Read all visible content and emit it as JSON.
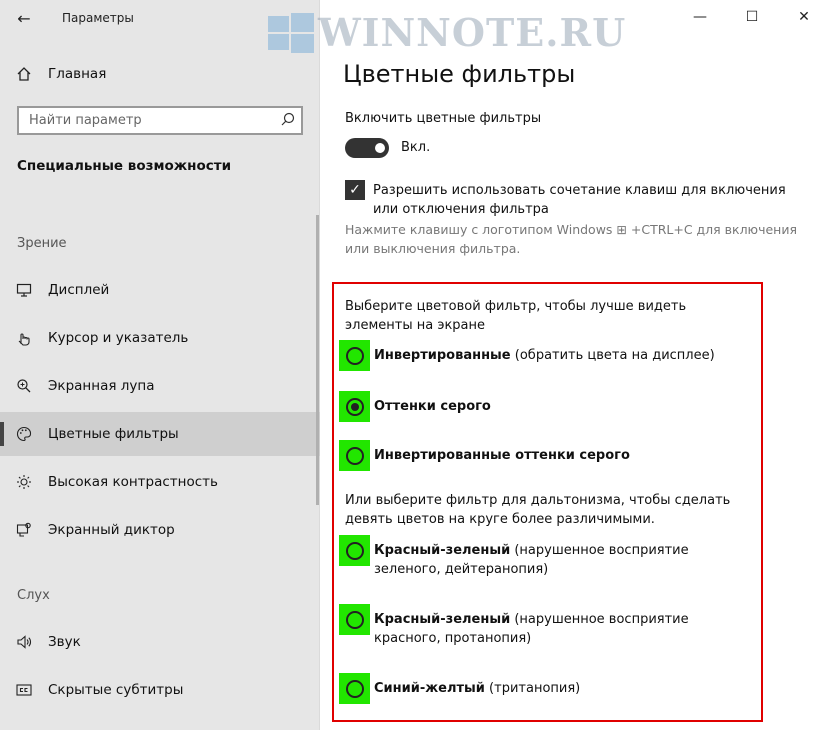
{
  "app": {
    "title": "Параметры",
    "back_icon": "arrow-left-icon"
  },
  "nav": {
    "home_label": "Главная",
    "search_placeholder": "Найти параметр",
    "section_title": "Специальные возможности",
    "groups": {
      "vision": "Зрение",
      "hearing": "Слух"
    },
    "items": [
      {
        "label": "Дисплей",
        "icon": "display-icon",
        "selected": false
      },
      {
        "label": "Курсор и указатель",
        "icon": "cursor-icon",
        "selected": false
      },
      {
        "label": "Экранная лупа",
        "icon": "magnifier-icon",
        "selected": false
      },
      {
        "label": "Цветные фильтры",
        "icon": "palette-icon",
        "selected": true
      },
      {
        "label": "Высокая контрастность",
        "icon": "brightness-icon",
        "selected": false
      },
      {
        "label": "Экранный диктор",
        "icon": "narrator-icon",
        "selected": false
      },
      {
        "label": "Звук",
        "icon": "speaker-icon",
        "selected": false
      },
      {
        "label": "Скрытые субтитры",
        "icon": "cc-icon",
        "selected": false
      }
    ]
  },
  "watermark": {
    "text": "WINNOTE.RU"
  },
  "main": {
    "title": "Цветные фильтры",
    "enable_label": "Включить цветные фильтры",
    "toggle_state": "Вкл.",
    "shortcut_label": "Разрешить использовать сочетание клавиш для включения или отключения фильтра",
    "hint": "Нажмите клавишу с логотипом Windows ⊞ +CTRL+C для включения или выключения фильтра.",
    "filters_desc": "Выберите цветовой фильтр, чтобы лучше видеть элементы на экране",
    "filters": [
      {
        "name": "Инвертированные",
        "detail": " (обратить цвета на дисплее)",
        "checked": false
      },
      {
        "name": "Оттенки серого",
        "detail": "",
        "checked": true
      },
      {
        "name": "Инвертированные оттенки серого",
        "detail": "",
        "checked": false
      }
    ],
    "cb_desc": "Или выберите фильтр для дальтонизма, чтобы сделать девять цветов на круге более различимыми.",
    "cb_filters": [
      {
        "name": "Красный-зеленый",
        "detail": " (нарушенное восприятие зеленого, дейтеранопия)",
        "checked": false
      },
      {
        "name": "Красный-зеленый",
        "detail": " (нарушенное восприятие красного, протанопия)",
        "checked": false
      },
      {
        "name": "Синий-желтый",
        "detail": " (тританопия)",
        "checked": false
      }
    ]
  }
}
